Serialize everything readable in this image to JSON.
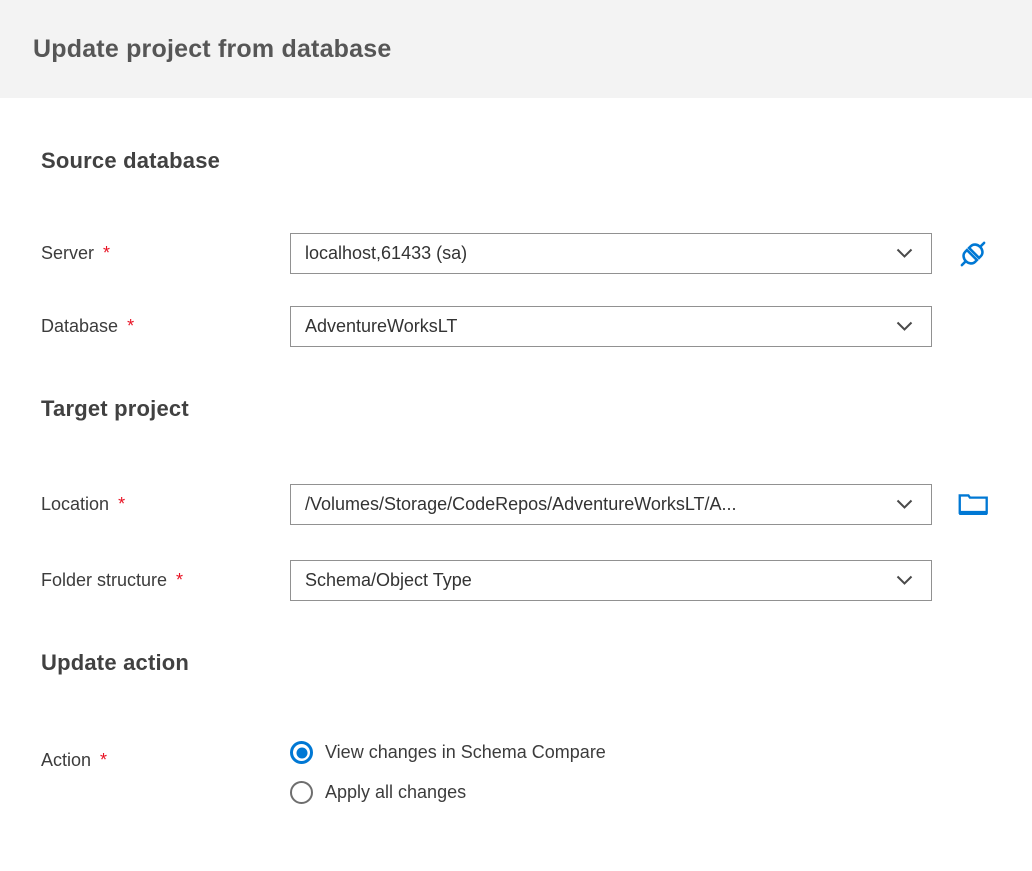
{
  "window": {
    "title": "Update project from database"
  },
  "colors": {
    "accent_blue": "#0078d4",
    "required_red": "#e81123",
    "header_bg": "#f3f3f3",
    "field_border": "#919191"
  },
  "sections": [
    {
      "heading": "Source database"
    },
    {
      "heading": "Target project"
    },
    {
      "heading": "Update action"
    }
  ],
  "fields": {
    "server": {
      "label": "Server",
      "required": "*",
      "value": "localhost,61433 (sa)"
    },
    "database": {
      "label": "Database",
      "required": "*",
      "value": "AdventureWorksLT"
    },
    "location": {
      "label": "Location",
      "required": "*",
      "value": "/Volumes/Storage/CodeRepos/AdventureWorksLT/A..."
    },
    "folder_structure": {
      "label": "Folder structure",
      "required": "*",
      "value": "Schema/Object Type"
    },
    "action": {
      "label": "Action",
      "required": "*",
      "options": [
        {
          "label": "View changes in Schema Compare",
          "selected": true
        },
        {
          "label": "Apply all changes",
          "selected": false
        }
      ]
    }
  },
  "icons": {
    "connect": "connect-plug-icon",
    "browse": "folder-icon",
    "dropdown": "chevron-down-icon"
  }
}
